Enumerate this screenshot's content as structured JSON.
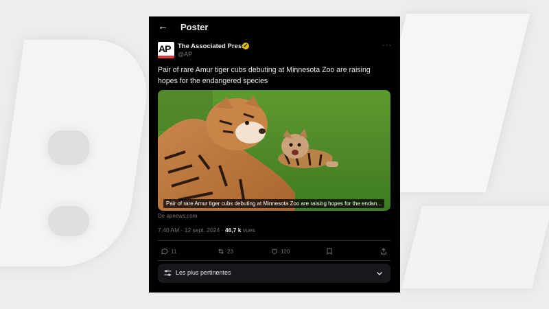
{
  "header": {
    "back_icon": "arrow-left-icon",
    "title": "Poster"
  },
  "author": {
    "name": "The Associated Press",
    "handle": "@AP",
    "avatar_text": "AP",
    "verified_color": "#e2b719"
  },
  "tweet": {
    "text": "Pair of rare Amur tiger cubs debuting at Minnesota Zoo are raising hopes for the endangered species",
    "media_caption": "Pair of rare Amur tiger cubs debuting at Minnesota Zoo are raising hopes for the endan...",
    "source": "De apnews.com",
    "time": "7:40 AM · 12 sept. 2024 · ",
    "views_count": "46,7 k",
    "views_label": " vues"
  },
  "actions": {
    "replies": "11",
    "reposts": "23",
    "likes": "120"
  },
  "sort": {
    "label": "Les plus pertinentes"
  },
  "colors": {
    "background": "#000000",
    "text": "#e7e9ea",
    "muted": "#71767b",
    "ap_red": "#e03a3e"
  }
}
